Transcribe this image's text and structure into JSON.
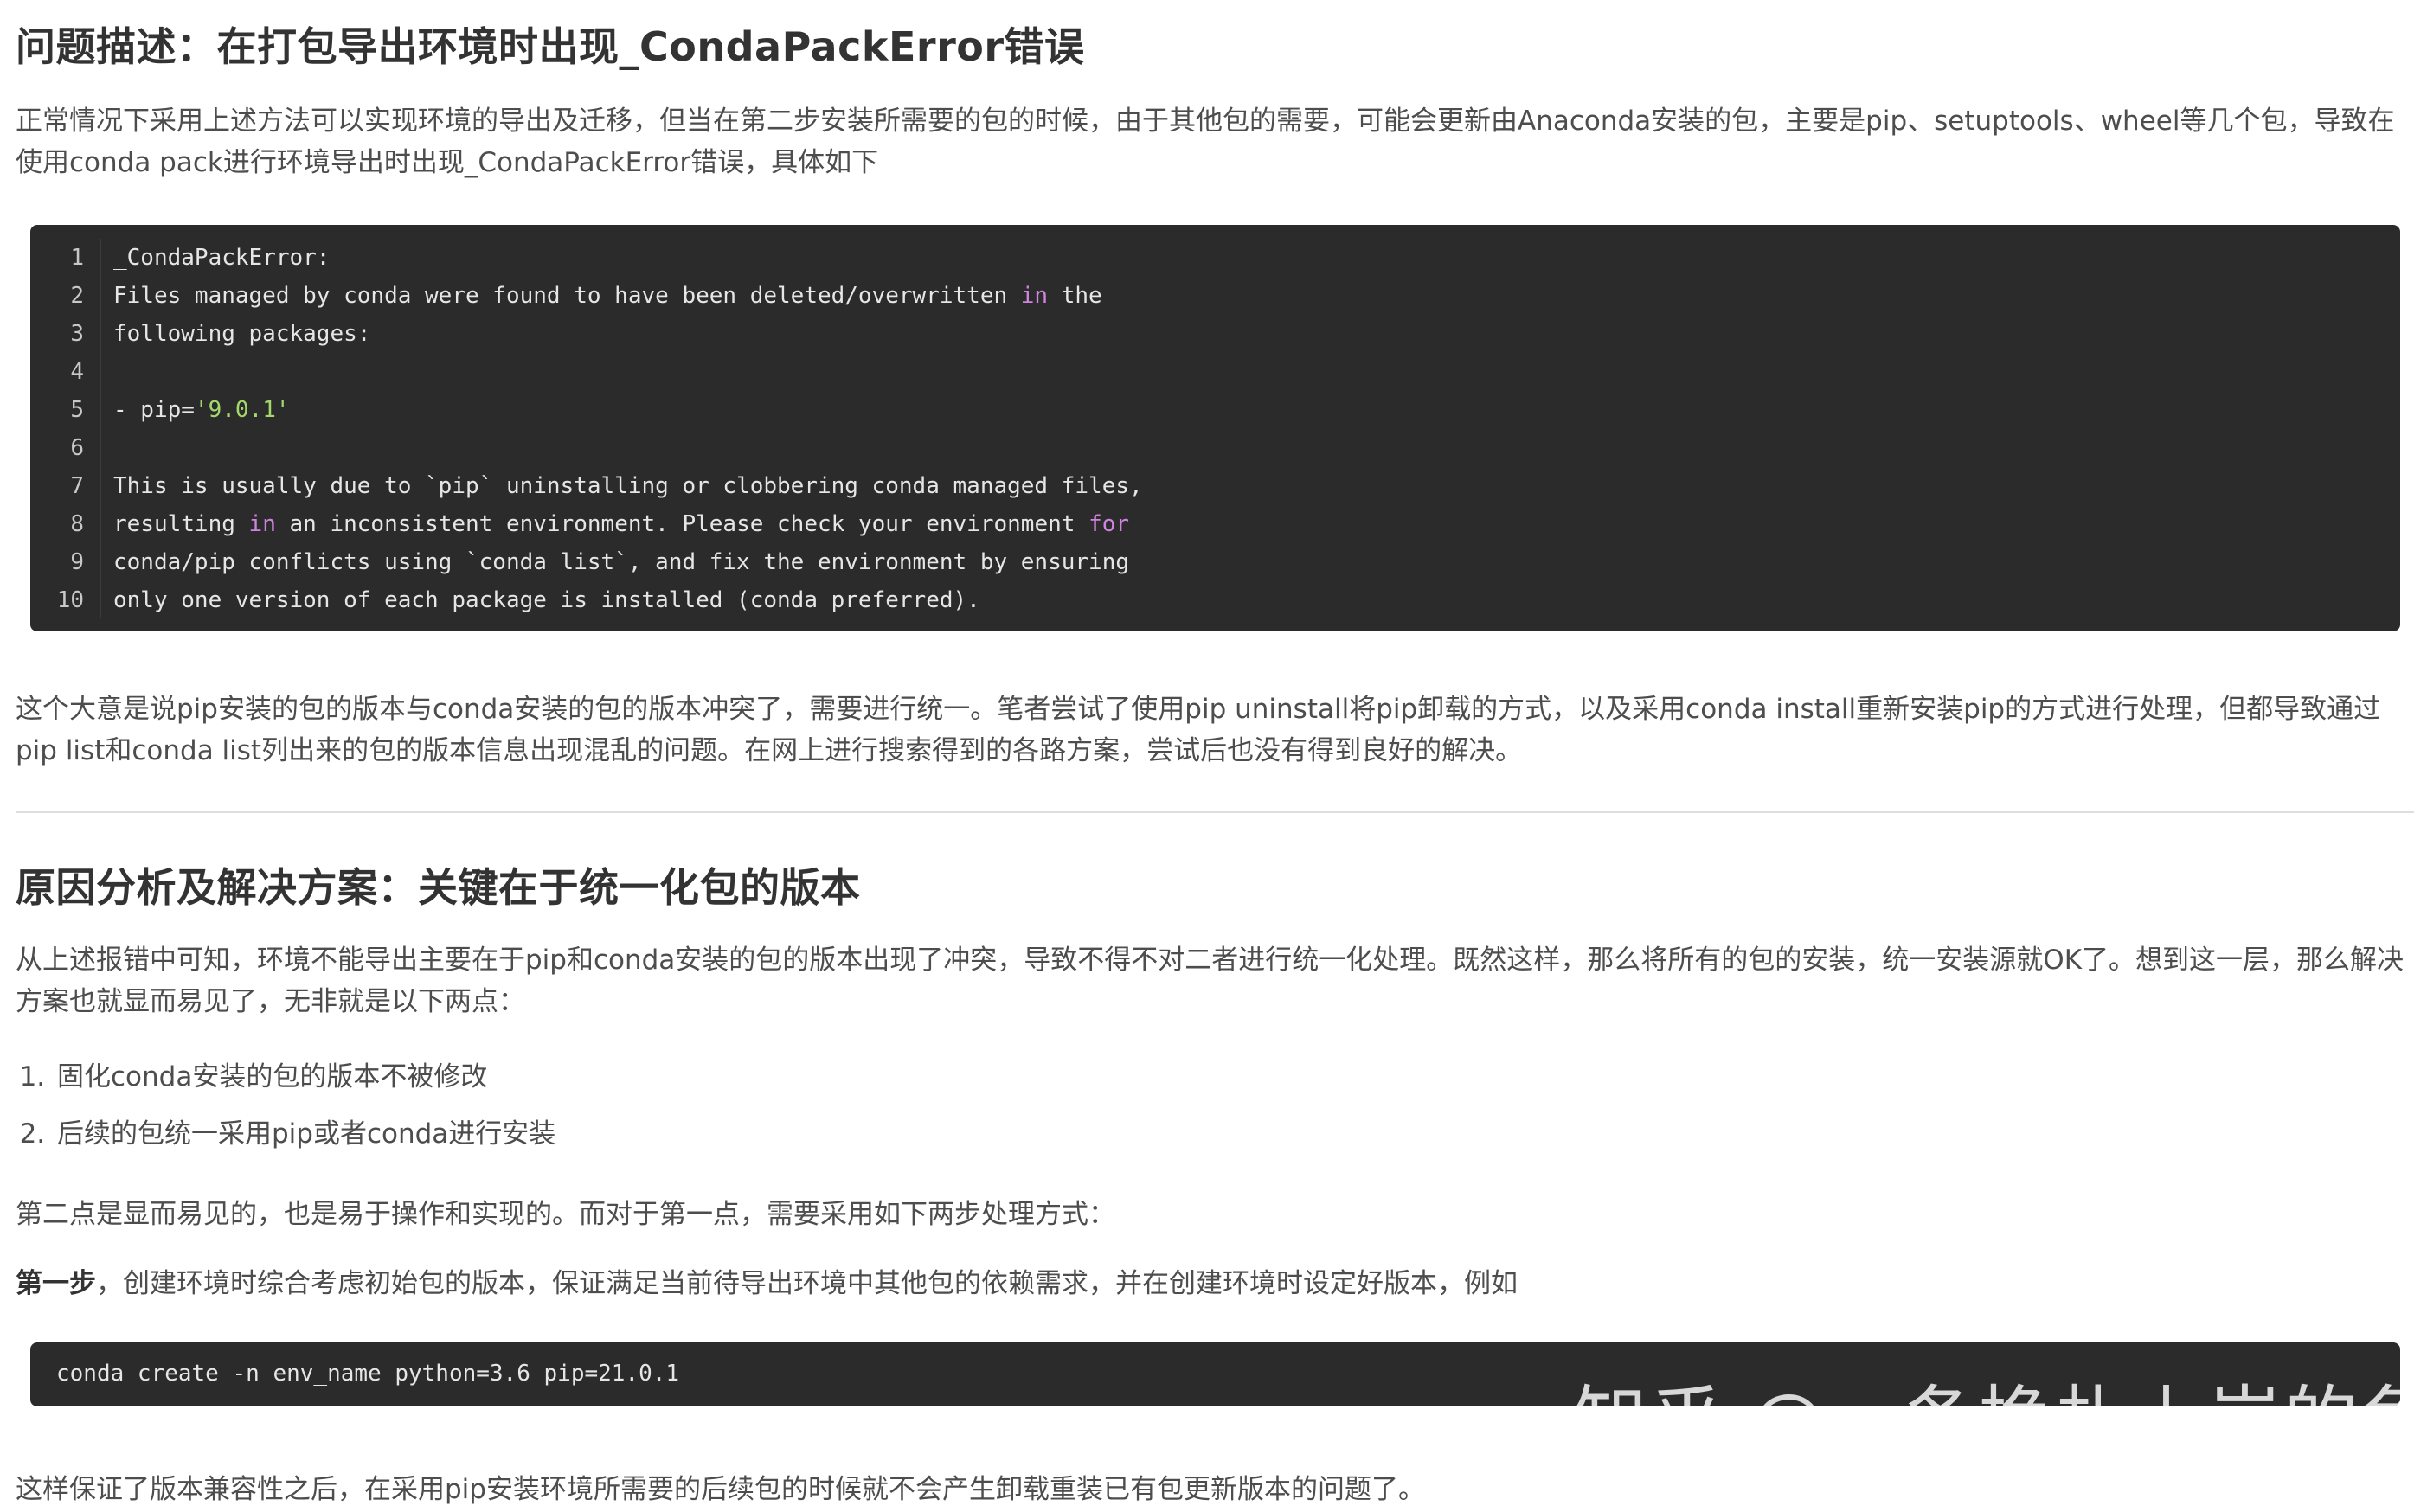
{
  "section1": {
    "heading": "问题描述：在打包导出环境时出现_CondaPackError错误",
    "para1": "正常情况下采用上述方法可以实现环境的导出及迁移，但当在第二步安装所需要的包的时候，由于其他包的需要，可能会更新由Anaconda安装的包，主要是pip、setuptools、wheel等几个包，导致在使用conda pack进行环境导出时出现_CondaPackError错误，具体如下",
    "code_lines": [
      {
        "num": "1",
        "parts": [
          {
            "t": "_CondaPackError:",
            "c": "plain"
          }
        ]
      },
      {
        "num": "2",
        "parts": [
          {
            "t": "Files managed by conda were found to have been deleted/overwritten ",
            "c": "plain"
          },
          {
            "t": "in",
            "c": "kw"
          },
          {
            "t": " the",
            "c": "plain"
          }
        ]
      },
      {
        "num": "3",
        "parts": [
          {
            "t": "following packages:",
            "c": "plain"
          }
        ]
      },
      {
        "num": "4",
        "parts": [
          {
            "t": "",
            "c": "plain"
          }
        ]
      },
      {
        "num": "5",
        "parts": [
          {
            "t": "- pip=",
            "c": "plain"
          },
          {
            "t": "'9.0.1'",
            "c": "str"
          }
        ]
      },
      {
        "num": "6",
        "parts": [
          {
            "t": "",
            "c": "plain"
          }
        ]
      },
      {
        "num": "7",
        "parts": [
          {
            "t": "This is usually due to `pip` uninstalling or clobbering conda managed files,",
            "c": "plain"
          }
        ]
      },
      {
        "num": "8",
        "parts": [
          {
            "t": "resulting ",
            "c": "plain"
          },
          {
            "t": "in",
            "c": "kw"
          },
          {
            "t": " an inconsistent environment. Please check your environment ",
            "c": "plain"
          },
          {
            "t": "for",
            "c": "kw"
          }
        ]
      },
      {
        "num": "9",
        "parts": [
          {
            "t": "conda/pip conflicts using `conda list`, and fix the environment by ensuring",
            "c": "plain"
          }
        ]
      },
      {
        "num": "10",
        "parts": [
          {
            "t": "only one version of each package is installed (conda preferred).",
            "c": "plain"
          }
        ]
      }
    ],
    "para2": "这个大意是说pip安装的包的版本与conda安装的包的版本冲突了，需要进行统一。笔者尝试了使用pip uninstall将pip卸载的方式，以及采用conda install重新安装pip的方式进行处理，但都导致通过pip list和conda list列出来的包的版本信息出现混乱的问题。在网上进行搜索得到的各路方案，尝试后也没有得到良好的解决。"
  },
  "section2": {
    "heading": "原因分析及解决方案：关键在于统一化包的版本",
    "para1": "从上述报错中可知，环境不能导出主要在于pip和conda安装的包的版本出现了冲突，导致不得不对二者进行统一化处理。既然这样，那么将所有的包的安装，统一安装源就OK了。想到这一层，那么解决方案也就显而易见了，无非就是以下两点：",
    "steps": [
      "固化conda安装的包的版本不被修改",
      "后续的包统一采用pip或者conda进行安装"
    ],
    "para2": "第二点是显而易见的，也是易于操作和实现的。而对于第一点，需要采用如下两步处理方式：",
    "step1_label": "第一步",
    "step1_text": "，创建环境时综合考虑初始包的版本，保证满足当前待导出环境中其他包的依赖需求，并在创建环境时设定好版本，例如",
    "code2": "conda create -n env_name python=3.6 pip=21.0.1",
    "para3": "这样保证了版本兼容性之后，在采用pip安装环境所需要的后续包的时候就不会产生卸载重装已有包更新版本的问题了。"
  },
  "watermark": "知乎 @一条挣扎上岸的鱼"
}
